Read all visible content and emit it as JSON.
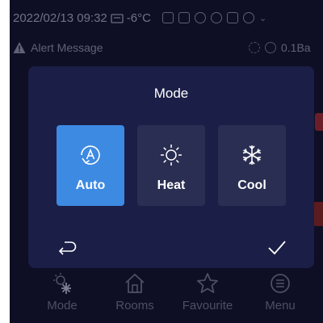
{
  "status_bar": {
    "datetime": "2022/02/13 09:32",
    "temperature": "-6°C"
  },
  "alert": {
    "message": "Alert Message",
    "pressure": "0.1Ba"
  },
  "dialog": {
    "title": "Mode",
    "options": [
      {
        "label": "Auto",
        "icon": "auto-mode-icon",
        "selected": true
      },
      {
        "label": "Heat",
        "icon": "sun-icon",
        "selected": false
      },
      {
        "label": "Cool",
        "icon": "snowflake-icon",
        "selected": false
      }
    ],
    "back_icon": "return-arrow-icon",
    "confirm_icon": "checkmark-icon"
  },
  "nav": {
    "items": [
      {
        "label": "Mode",
        "icon": "mode-icon"
      },
      {
        "label": "Rooms",
        "icon": "home-icon"
      },
      {
        "label": "Favourite",
        "icon": "star-icon"
      },
      {
        "label": "Menu",
        "icon": "menu-icon"
      }
    ]
  },
  "colors": {
    "screen_bg": "#0e0f24",
    "dialog_bg": "#1b1e46",
    "option_bg": "#2a2e52",
    "selected_bg": "#3d8ae3"
  }
}
